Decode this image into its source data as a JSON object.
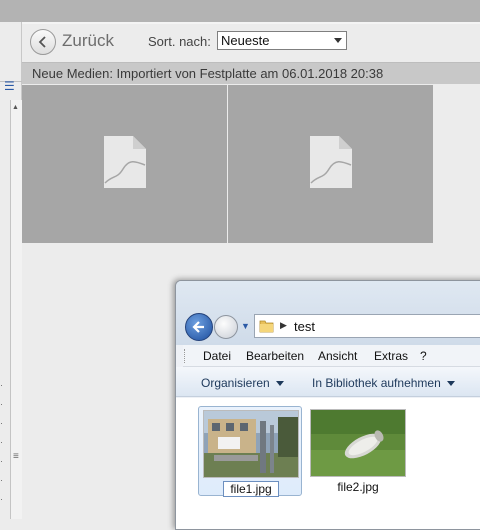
{
  "header": {
    "back_label": "Zurück",
    "sort_label": "Sort. nach:",
    "sort_value": "Neueste"
  },
  "info_bar": {
    "text": "Neue Medien: Importiert von Festplatte am 06.01.2018 20:38"
  },
  "media": {
    "items": [
      {
        "type": "file-placeholder"
      },
      {
        "type": "file-placeholder"
      }
    ]
  },
  "explorer": {
    "address": "test",
    "menu": [
      "Datei",
      "Bearbeiten",
      "Ansicht",
      "Extras",
      "?"
    ],
    "commands": [
      "Organisieren",
      "In Bibliothek aufnehmen"
    ],
    "files": [
      {
        "name": "file1.jpg",
        "selected": true
      },
      {
        "name": "file2.jpg",
        "selected": false
      }
    ]
  },
  "colors": {
    "accent": "#2b5aa6",
    "thumb_bg": "#a6a6a6"
  }
}
